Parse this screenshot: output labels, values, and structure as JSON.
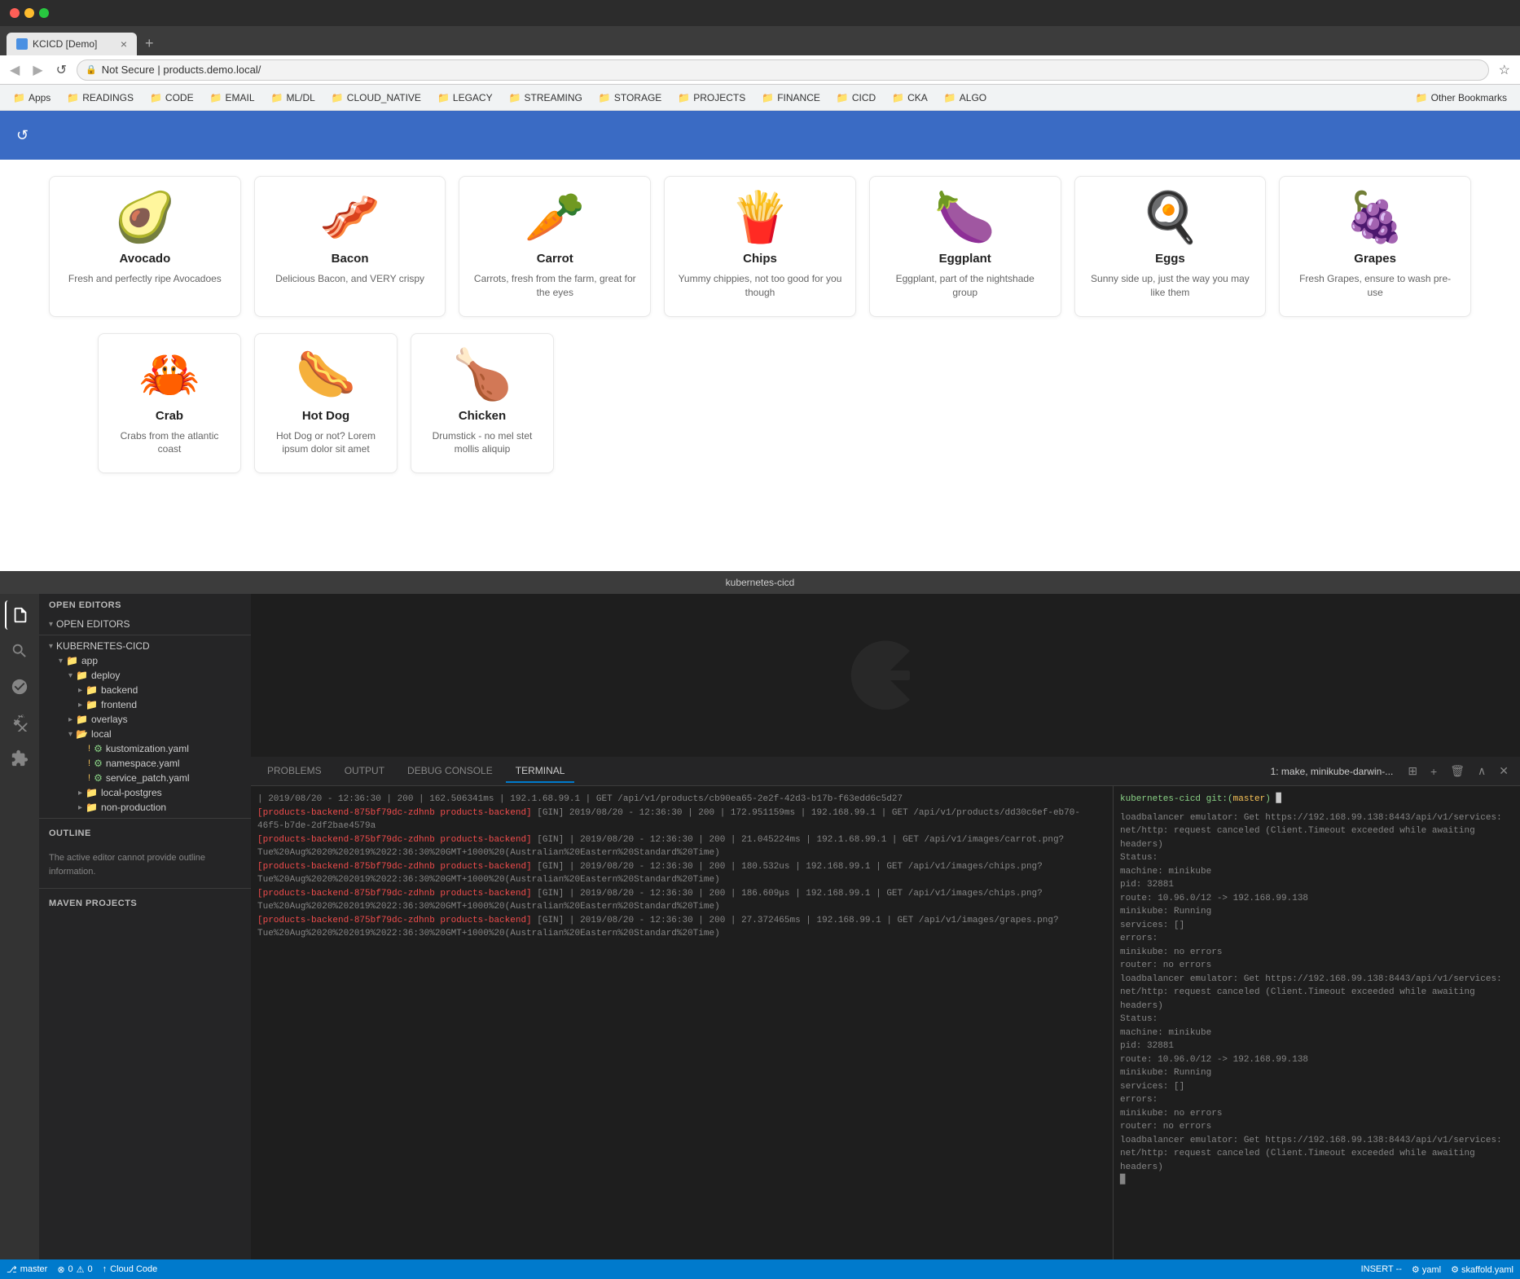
{
  "browser": {
    "tab_title": "KCICD [Demo]",
    "url": "products.demo.local/",
    "url_display": "Not Secure | products.demo.local/",
    "bookmarks": [
      {
        "label": "Apps",
        "icon": "📁"
      },
      {
        "label": "READINGS",
        "icon": "📁"
      },
      {
        "label": "CODE",
        "icon": "📁"
      },
      {
        "label": "EMAIL",
        "icon": "📁"
      },
      {
        "label": "ML/DL",
        "icon": "📁"
      },
      {
        "label": "CLOUD_NATIVE",
        "icon": "📁"
      },
      {
        "label": "LEGACY",
        "icon": "📁"
      },
      {
        "label": "STREAMING",
        "icon": "📁"
      },
      {
        "label": "STORAGE",
        "icon": "📁"
      },
      {
        "label": "PROJECTS",
        "icon": "📁"
      },
      {
        "label": "FINANCE",
        "icon": "📁"
      },
      {
        "label": "CICD",
        "icon": "📁"
      },
      {
        "label": "CKA",
        "icon": "📁"
      },
      {
        "label": "ALGO",
        "icon": "📁"
      }
    ],
    "other_bookmarks": "Other Bookmarks"
  },
  "products": [
    {
      "name": "Avocado",
      "emoji": "🥑",
      "desc": "Fresh and perfectly ripe Avocadoes"
    },
    {
      "name": "Bacon",
      "emoji": "🥓",
      "desc": "Delicious Bacon, and VERY crispy"
    },
    {
      "name": "Carrot",
      "emoji": "🥕",
      "desc": "Carrots, fresh from the farm, great for the eyes"
    },
    {
      "name": "Chips",
      "emoji": "🍟",
      "desc": "Yummy chippies, not too good for you though"
    },
    {
      "name": "Eggplant",
      "emoji": "🍆",
      "desc": "Eggplant, part of the nightshade group"
    },
    {
      "name": "Eggs",
      "emoji": "🍳",
      "desc": "Sunny side up, just the way you may like them"
    },
    {
      "name": "Grapes",
      "emoji": "🍇",
      "desc": "Fresh Grapes, ensure to wash pre-use"
    },
    {
      "name": "Crab",
      "emoji": "🦀",
      "desc": "Crabs from the atlantic coast"
    },
    {
      "name": "Hot Dog",
      "emoji": "🌭",
      "desc": "Hot Dog or not? Lorem ipsum dolor sit amet"
    },
    {
      "name": "Chicken",
      "emoji": "🍗",
      "desc": "Drumstick - no mel stet mollis aliquip"
    }
  ],
  "vscode": {
    "title": "kubernetes-cicd",
    "sections": {
      "open_editors": "OPEN EDITORS",
      "kubernetes_cicd": "KUBERNETES-CICD",
      "outline": "OUTLINE",
      "maven_projects": "MAVEN PROJECTS"
    },
    "tree": [
      {
        "label": "app",
        "indent": 1,
        "type": "folder",
        "open": true
      },
      {
        "label": "deploy",
        "indent": 2,
        "type": "folder",
        "open": true
      },
      {
        "label": "backend",
        "indent": 3,
        "type": "folder",
        "open": false
      },
      {
        "label": "frontend",
        "indent": 3,
        "type": "folder",
        "open": false
      },
      {
        "label": "overlays",
        "indent": 2,
        "type": "folder",
        "open": false
      },
      {
        "label": "local",
        "indent": 3,
        "type": "folder",
        "open": true
      },
      {
        "label": "kustomization.yaml",
        "indent": 4,
        "type": "yaml"
      },
      {
        "label": "namespace.yaml",
        "indent": 4,
        "type": "yaml"
      },
      {
        "label": "service_patch.yaml",
        "indent": 4,
        "type": "yaml"
      },
      {
        "label": "local-postgres",
        "indent": 3,
        "type": "folder",
        "open": false
      },
      {
        "label": "non-production",
        "indent": 3,
        "type": "folder",
        "open": false
      }
    ],
    "outline_text": "The active editor cannot provide outline information.",
    "terminal_tabs": [
      "PROBLEMS",
      "OUTPUT",
      "DEBUG CONSOLE",
      "TERMINAL"
    ],
    "active_tab": "TERMINAL",
    "terminal_name": "1: make, minikube-darwin-...",
    "terminal_prompt": "kubernetes-cicd git:(master) ▊"
  },
  "terminal_logs": [
    "| 2019/08/20 - 12:36:30 | 200 |  162.506341ms |   192.1.68.99.1 | GET    /api/v1/products/cb90ea65-2e2f-42d3-b17b-f63edd6c5d27",
    "[products-backend-875bf79dc-zdhnb products-backend] [GIN] 2019/08/20 - 12:36:30 | 200 |  172.951159ms |   192.168.99.1 | GET    /api/v1/products/dd30c6ef-eb70-46f5-b7de-2df2bae4579a",
    "[products-backend-875bf79dc-zdhnb products-backend] [GIN] 2019/08/20 - 12:36:30 | 200 |   21.045224ms |  192.1.68.99.1 | GET    /api/v1/images/carrot.png?Tue%20Aug%2020%202019%2022:36:30%20GMT+1000%20(Australian%20Eastern%20Standard%20Time)",
    "[products-backend-875bf79dc-zdhnb products-backend] [GIN] 2019/08/20 - 12:36:30 | 200 |   180.532us  |  192.168.99.1 | GET    /api/v1/images/chips.png?Tue%20Aug%2020%202019%2022:36:30%20GMT+1000%20(Australian%20Eastern%20Standard%20Time)",
    "[products-backend-875bf79dc-zdhnb products-backend] [GIN] 2019/08/20 - 12:36:30 | 200 |   186.609μs  |  192.168.99.1 | GET    /api/v1/images/chips.png?Tue%20Aug%2020%202019%2022:36:30%20GMT+1000%20(Australian%20Eastern%20Standard%20Time)",
    "[products-backend-875bf79dc-zdhnb products-backend] [GIN] 2019/08/20 - 12:36:30 | 200 |   27.372465ms |   192.168.99.1 | GET    /api/v1/images/grapes.png?Tue%20Aug%2020%202019%2022:36:30%20GMT+1000%20(Australian%20Eastern%20Standard%20Time)"
  ],
  "terminal_right_logs": [
    "loadbalancer emulator: Get https://192.168.99.138:8443/api/v1/services: net/http: request canceled (Client.Timeout exceeded while awaiting headers)",
    "Status:",
    "    machine: minikube",
    "    pid: 32881",
    "    route: 10.96.0/12 -> 192.168.99.138",
    "    minikube: Running",
    "    services: []",
    "errors:",
    "    minikube: no errors",
    "    router: no errors",
    "    loadbalancer emulator: Get https://192.168.99.138:8443/api/v1/services: net/http: request canceled (Client.Timeout exceeded while awaiting headers)",
    "Status:",
    "    machine: minikube",
    "    pid: 32881",
    "    route: 10.96.0/12 -> 192.168.99.138",
    "    minikube: Running",
    "    services: []",
    "errors:",
    "    minikube: no errors",
    "    router: no errors",
    "    loadbalancer emulator: Get https://192.168.99.138:8443/api/v1/services: net/http: request canceled (Client.Timeout exceeded while awaiting headers)",
    "▊"
  ],
  "status_bar": {
    "branch": "master",
    "errors": "0",
    "warnings": "0",
    "sync": "Cloud Code",
    "insert": "INSERT --",
    "files": [
      "yaml",
      "skaffold.yaml"
    ]
  }
}
